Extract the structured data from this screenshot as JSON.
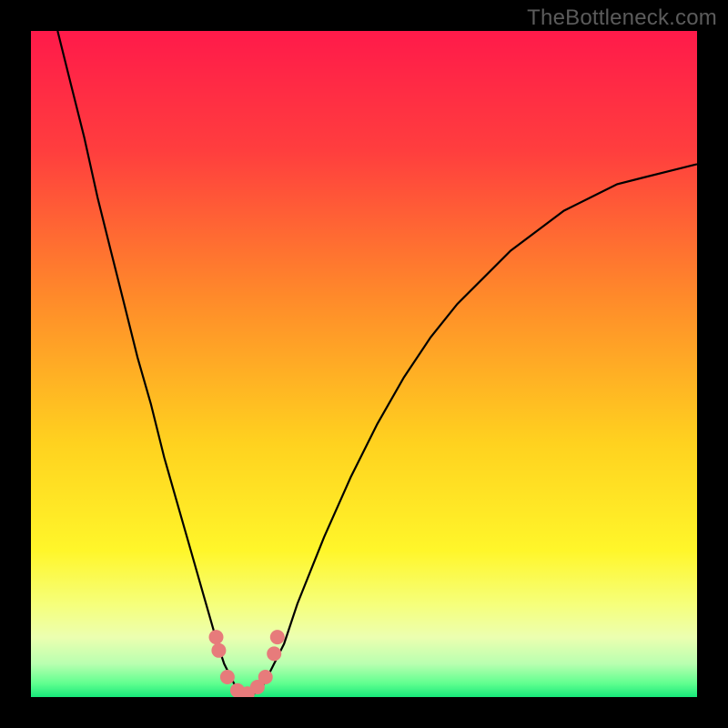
{
  "watermark": "TheBottleneck.com",
  "colors": {
    "gradient": [
      "#ff1a4a",
      "#ff3e3e",
      "#ff8a2a",
      "#ffd21f",
      "#fff62a",
      "#f6ff7a",
      "#ecffb0",
      "#b9ffb0",
      "#5fff8f",
      "#17e87a"
    ],
    "curve": "#000000",
    "markers": "#e77b7b",
    "frame": "#000000"
  },
  "chart_data": {
    "type": "line",
    "title": "",
    "xlabel": "",
    "ylabel": "",
    "xlim": [
      0,
      100
    ],
    "ylim": [
      0,
      100
    ],
    "x_optimum": 32,
    "series": [
      {
        "name": "bottleneck",
        "x": [
          4,
          6,
          8,
          10,
          12,
          14,
          16,
          18,
          20,
          22,
          24,
          26,
          28,
          29,
          30,
          31,
          32,
          33,
          34,
          35,
          36,
          38,
          40,
          44,
          48,
          52,
          56,
          60,
          64,
          68,
          72,
          76,
          80,
          84,
          88,
          92,
          96,
          100
        ],
        "y": [
          100,
          92,
          84,
          75,
          67,
          59,
          51,
          44,
          36,
          29,
          22,
          15,
          8,
          5,
          3,
          1,
          0,
          0,
          1,
          2,
          4,
          8,
          14,
          24,
          33,
          41,
          48,
          54,
          59,
          63,
          67,
          70,
          73,
          75,
          77,
          78,
          79,
          80
        ]
      }
    ],
    "markers": {
      "name": "near-optimal",
      "points": [
        {
          "x": 27.8,
          "y": 9.0
        },
        {
          "x": 28.2,
          "y": 7.0
        },
        {
          "x": 29.5,
          "y": 3.0
        },
        {
          "x": 31.0,
          "y": 1.0
        },
        {
          "x": 32.5,
          "y": 0.5
        },
        {
          "x": 34.0,
          "y": 1.5
        },
        {
          "x": 35.2,
          "y": 3.0
        },
        {
          "x": 36.5,
          "y": 6.5
        },
        {
          "x": 37.0,
          "y": 9.0
        }
      ],
      "radius": 8
    },
    "legend": false,
    "grid": false
  }
}
